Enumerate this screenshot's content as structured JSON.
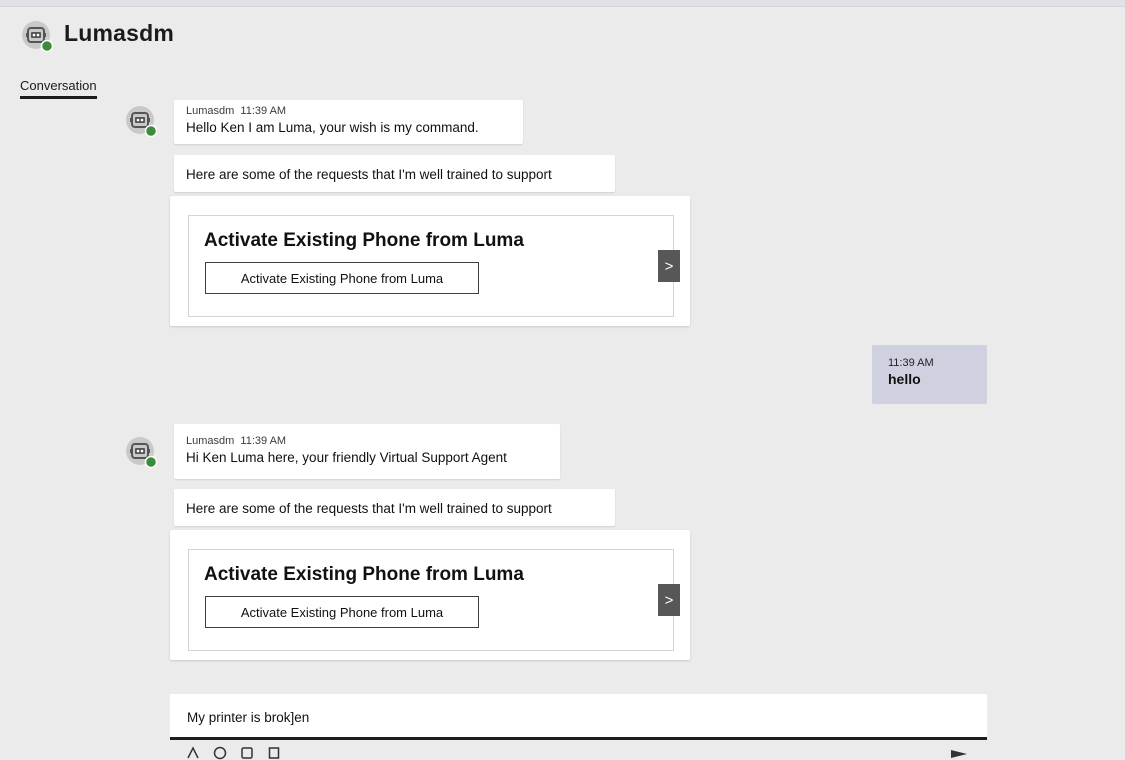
{
  "app": {
    "title": "Lumasdm",
    "tab_label": "Conversation"
  },
  "messages": [
    {
      "sender": "Lumasdm",
      "time": "11:39 AM",
      "text": "Hello Ken I am Luma, your wish is my command.",
      "followup": "Here are some of the requests that I'm well trained to support",
      "card": {
        "title": "Activate Existing Phone from Luma",
        "button_label": "Activate Existing Phone from Luma",
        "next_glyph": ">"
      }
    },
    {
      "sender": "Lumasdm",
      "time": "11:39 AM",
      "text": "Hi Ken Luma here, your friendly Virtual Support Agent",
      "followup": "Here are some of the requests that I'm well trained to support",
      "card": {
        "title": "Activate Existing Phone from Luma",
        "button_label": "Activate Existing Phone from Luma",
        "next_glyph": ">"
      }
    }
  ],
  "user_message": {
    "time": "11:39 AM",
    "text": "hello"
  },
  "composer": {
    "value": "My printer is brok]en"
  },
  "icons": {
    "bot_avatar": "bot-avatar-icon",
    "online_badge": "online-status-icon",
    "send": "send-icon"
  },
  "colors": {
    "background": "#ebebeb",
    "user_bubble": "#cfd1e0",
    "online": "#3c8a3c",
    "card_next_button": "#575757"
  }
}
